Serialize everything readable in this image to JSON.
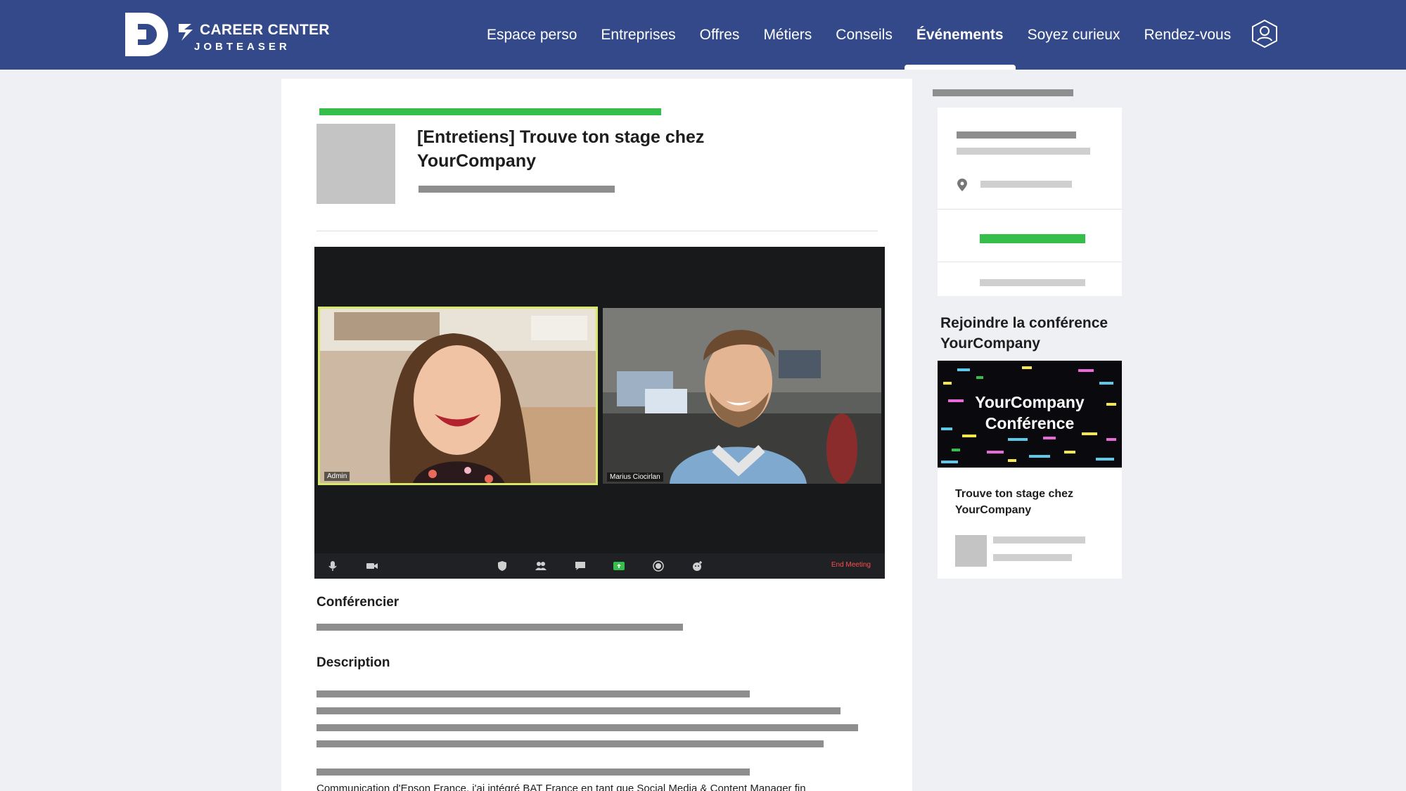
{
  "header": {
    "brand_line1": "CAREER CENTER",
    "brand_line2": "JOBTEASER",
    "nav": [
      {
        "label": "Espace perso",
        "active": false
      },
      {
        "label": "Entreprises",
        "active": false
      },
      {
        "label": "Offres",
        "active": false
      },
      {
        "label": "Métiers",
        "active": false
      },
      {
        "label": "Conseils",
        "active": false
      },
      {
        "label": "Événements",
        "active": true
      },
      {
        "label": "Soyez curieux",
        "active": false
      },
      {
        "label": "Rendez-vous",
        "active": false
      }
    ],
    "profile_icon": "user-hexagon-icon",
    "colors": {
      "header_bg": "#33498a",
      "accent_green": "#36be4a"
    }
  },
  "event": {
    "title": "[Entretiens] Trouve ton stage chez YourCompany",
    "video": {
      "participants": [
        {
          "name": "Admin",
          "speaking": true
        },
        {
          "name": "Marius Ciocirlan",
          "speaking": false
        }
      ],
      "toolbar_icons": [
        "microphone-icon",
        "video-camera-icon",
        "security-icon",
        "participants-icon",
        "chat-icon",
        "share-screen-icon",
        "record-icon",
        "reactions-icon"
      ],
      "end_label": "End Meeting"
    },
    "speaker_heading": "Conférencier",
    "description_heading": "Description",
    "description_partial": "Communication d'Epson France, j'ai intégré BAT France en tant que Social Media & Content Manager fin"
  },
  "sidebar": {
    "location_icon": "map-pin-icon",
    "join_title": "Rejoindre la conférence YourCompany",
    "conference": {
      "banner_line1": "YourCompany",
      "banner_line2": "Conférence",
      "event_title": "Trouve ton stage chez YourCompany"
    }
  }
}
